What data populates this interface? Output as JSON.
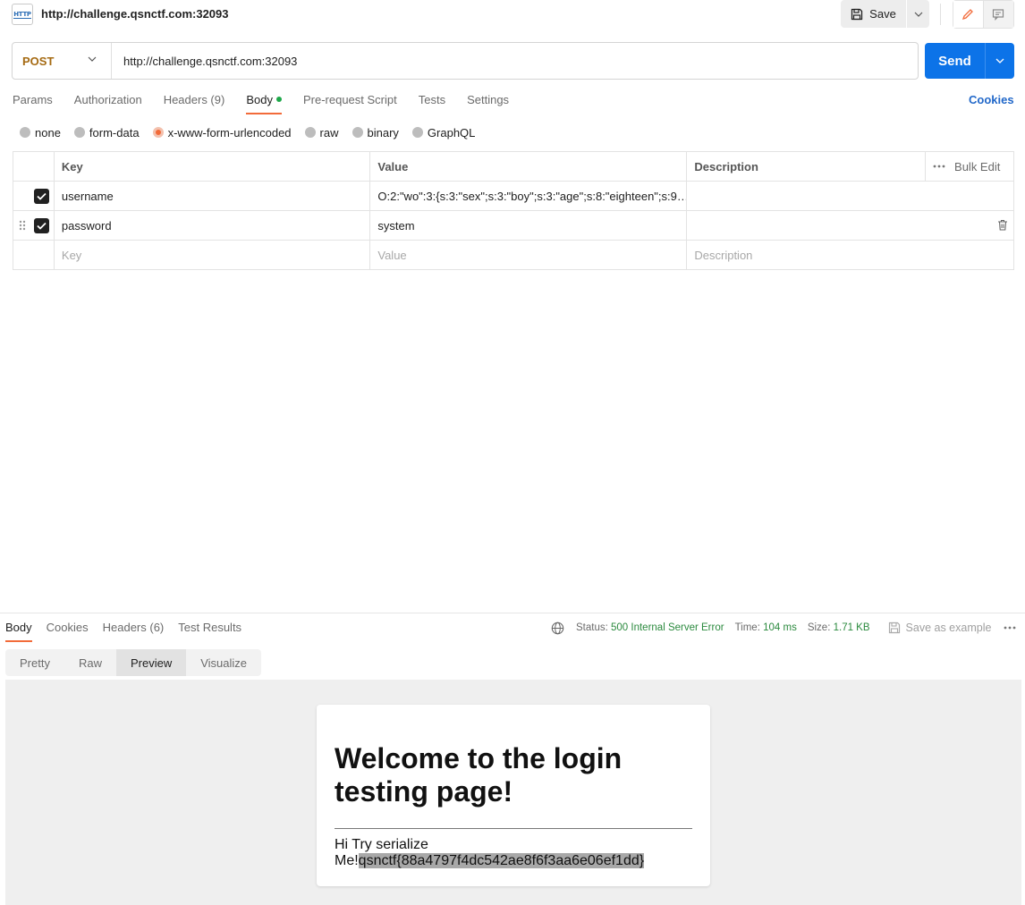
{
  "header": {
    "title": "http://challenge.qsnctf.com:32093",
    "badge": "HTTP",
    "save_label": "Save"
  },
  "request": {
    "method": "POST",
    "url": "http://challenge.qsnctf.com:32093",
    "send_label": "Send"
  },
  "tabs": {
    "params": "Params",
    "authorization": "Authorization",
    "headers": "Headers (9)",
    "body": "Body",
    "prerequest": "Pre-request Script",
    "tests": "Tests",
    "settings": "Settings",
    "cookies": "Cookies"
  },
  "body_types": {
    "none": "none",
    "form_data": "form-data",
    "urlencoded": "x-www-form-urlencoded",
    "raw": "raw",
    "binary": "binary",
    "graphql": "GraphQL",
    "selected": "x-www-form-urlencoded"
  },
  "table": {
    "headers": {
      "key": "Key",
      "value": "Value",
      "description": "Description",
      "bulk_edit": "Bulk Edit"
    },
    "rows": [
      {
        "key": "username",
        "value": "O:2:\"wo\":3:{s:3:\"sex\";s:3:\"boy\";s:3:\"age\";s:8:\"eighteen\";s:9…",
        "description": "",
        "checked": true
      },
      {
        "key": "password",
        "value": "system",
        "description": "",
        "checked": true
      }
    ],
    "placeholders": {
      "key": "Key",
      "value": "Value",
      "description": "Description"
    }
  },
  "response": {
    "tabs": {
      "body": "Body",
      "cookies": "Cookies",
      "headers": "Headers (6)",
      "test_results": "Test Results"
    },
    "status_label": "Status:",
    "status_value": "500 Internal Server Error",
    "time_label": "Time:",
    "time_value": "104 ms",
    "size_label": "Size:",
    "size_value": "1.71 KB",
    "save_example": "Save as example",
    "views": {
      "pretty": "Pretty",
      "raw": "Raw",
      "preview": "Preview",
      "visualize": "Visualize"
    },
    "preview": {
      "heading": "Welcome to the login testing page!",
      "line1": "Hi Try serialize",
      "line2_prefix": "Me!",
      "flag": "qsnctf{88a4797f4dc542ae8f6f3aa6e06ef1dd}"
    }
  },
  "colors": {
    "send": "#0c73e8",
    "method": "#a56a12",
    "accent": "#f26b3a",
    "status_ok": "#2b8a3e",
    "link": "#2268c9"
  }
}
